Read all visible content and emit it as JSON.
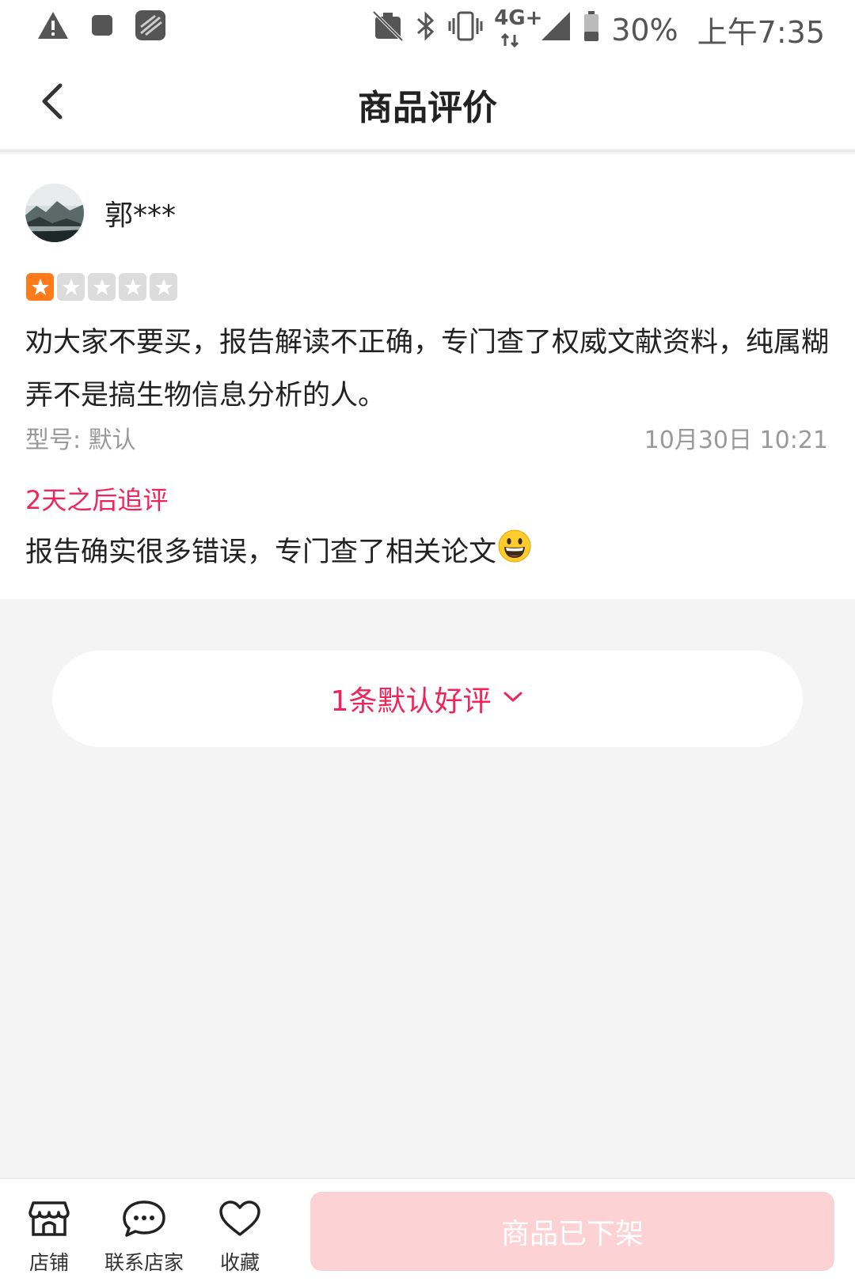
{
  "status_bar": {
    "battery": "30%",
    "time": "上午7:35",
    "network": "4G+"
  },
  "header": {
    "title": "商品评价"
  },
  "review": {
    "username": "郭***",
    "rating": 1,
    "rating_max": 5,
    "content": "劝大家不要买，报告解读不正确，专门查了权威文献资料，纯属糊弄不是搞生物信息分析的人。",
    "model": "型号: 默认",
    "date": "10月30日 10:21",
    "followup_title": "2天之后追评",
    "followup_content": "报告确实很多错误，专门查了相关论文"
  },
  "more": {
    "label": "1条默认好评"
  },
  "bottom_bar": {
    "store_label": "店铺",
    "contact_label": "联系店家",
    "favorite_label": "收藏",
    "status_button": "商品已下架"
  },
  "colors": {
    "accent": "#f0245a",
    "star_active": "#ff7a1a",
    "star_inactive": "#dcdcdc",
    "offshelf_bg": "#fdd2d5"
  }
}
